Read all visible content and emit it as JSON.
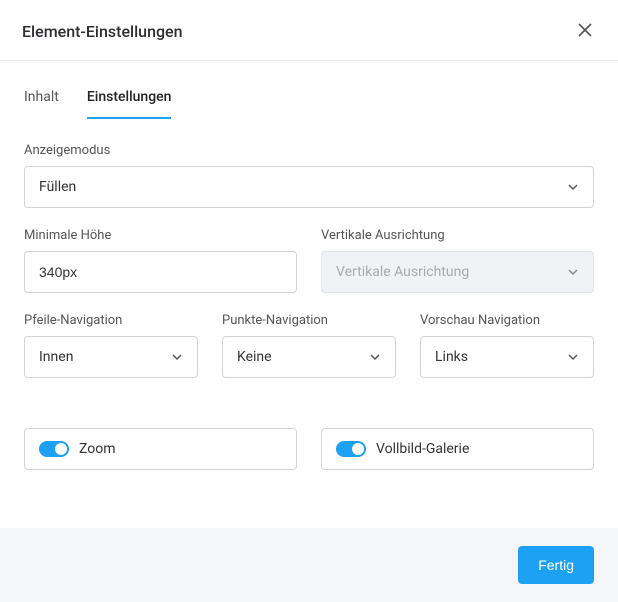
{
  "header": {
    "title": "Element-Einstellungen"
  },
  "tabs": {
    "content": "Inhalt",
    "settings": "Einstellungen"
  },
  "fields": {
    "displayMode": {
      "label": "Anzeigemodus",
      "value": "Füllen"
    },
    "minHeight": {
      "label": "Minimale Höhe",
      "value": "340px"
    },
    "verticalAlign": {
      "label": "Vertikale Ausrichtung",
      "placeholder": "Vertikale Ausrichtung"
    },
    "arrowNav": {
      "label": "Pfeile-Navigation",
      "value": "Innen"
    },
    "dotNav": {
      "label": "Punkte-Navigation",
      "value": "Keine"
    },
    "thumbNav": {
      "label": "Vorschau Navigation",
      "value": "Links"
    },
    "zoom": {
      "label": "Zoom"
    },
    "fullscreen": {
      "label": "Vollbild-Galerie"
    }
  },
  "footer": {
    "done": "Fertig"
  }
}
